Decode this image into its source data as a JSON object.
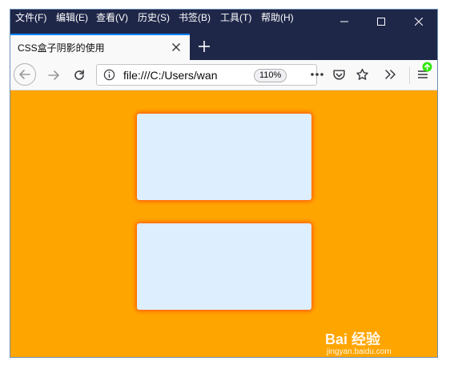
{
  "menubar": {
    "items": [
      "文件(F)",
      "编辑(E)",
      "查看(V)",
      "历史(S)",
      "书签(B)",
      "工具(T)",
      "帮助(H)"
    ]
  },
  "window_controls": [
    "minimize-icon",
    "maximize-icon",
    "close-icon"
  ],
  "tab": {
    "title": "CSS盒子阴影的使用",
    "close_icon": "close-icon",
    "new_tab_icon": "plus-icon"
  },
  "navbar": {
    "back_icon": "arrow-left-icon",
    "forward_icon": "arrow-right-icon",
    "reload_icon": "reload-icon",
    "info_icon": "info-icon",
    "url": "file:///C:/Users/wan",
    "zoom": "110%",
    "page_actions_icon": "more-horizontal-icon",
    "pocket_icon": "pocket-icon",
    "bookmark_icon": "star-icon",
    "overflow_icon": "chevrons-right-icon",
    "menu_icon": "hamburger-menu-icon",
    "update_badge_color": "#30e60b"
  },
  "content": {
    "background_color": "#ffa500",
    "box_color": "#ddeefe",
    "shadow_color": "#ff4a00",
    "boxes": 2
  },
  "watermark": {
    "logo": "Bai 经验",
    "domain": "jingyan.baidu.com"
  }
}
